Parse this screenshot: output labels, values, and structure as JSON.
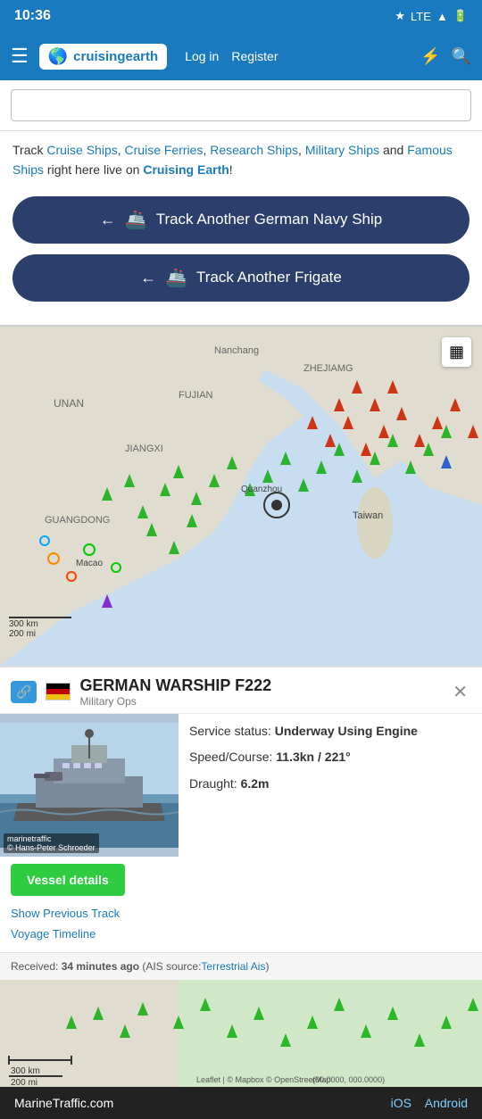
{
  "statusBar": {
    "time": "10:36",
    "icons": "🔵 LTE ▲ 🔋"
  },
  "navbar": {
    "logo": "cruisingearth",
    "login": "Log in",
    "register": "Register"
  },
  "trackText": {
    "prefix": "Track ",
    "links": [
      "Cruise Ships",
      "Cruise Ferries",
      "Research Ships",
      "Military Ships"
    ],
    "mid": " and ",
    "links2": [
      "Famous Ships"
    ],
    "suffix": " right here live on ",
    "brandBold": "Cruising Earth",
    "end": "!"
  },
  "buttons": {
    "trackNavy": "Track Another German Navy Ship",
    "trackFrigate": "Track Another Frigate"
  },
  "ship": {
    "name": "GERMAN WARSHIP F222",
    "type": "Military Ops",
    "serviceStatusLabel": "Service status: ",
    "serviceStatus": "Underway Using Engine",
    "speedLabel": "Speed/Course: ",
    "speed": "11.3kn / 221°",
    "draughtLabel": "Draught: ",
    "draught": "6.2m",
    "vesselDetailsBtn": "Vessel details",
    "showPreviousTrack": "Show Previous Track",
    "voyageTimeline": "Voyage Timeline"
  },
  "received": {
    "label": "Received: ",
    "time": "34 minutes ago",
    "aisLabel": " (AIS source:",
    "aisSource": "Terrestrial Ais",
    "end": ")"
  },
  "mapLabels": {
    "nanchang": "Nanchang",
    "jiangxi": "JIANGXI",
    "fujian": "FUJIAN",
    "guangdong": "GUANGDONG",
    "zhejiang": "ZHEJIAMG",
    "taiwan": "Taiwan",
    "quanzhou": "Quanzhou",
    "macao": "Macao"
  },
  "scale": {
    "km": "300 km",
    "mi": "200 mi"
  },
  "coords": "(00.0000, 000.0000)",
  "leafletAttr": "Leaflet | © Mapbox © OpenStreetMap",
  "footer": {
    "site": "MarineTraffic.com",
    "ios": "iOS",
    "android": "Android"
  },
  "imageCaption": "marinetraffic\n© Hans-Peter Schroeder"
}
